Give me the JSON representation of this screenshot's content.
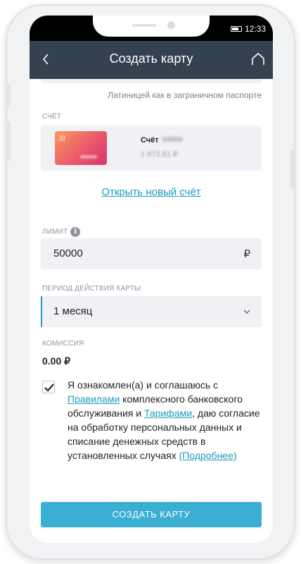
{
  "status_bar": {
    "time": "12:33"
  },
  "header": {
    "title": "Создать карту"
  },
  "name_field": {
    "hint": "Латиницей как в заграничном паспорте"
  },
  "account": {
    "label": "СЧЁТ",
    "title": "Счёт",
    "balance": "1 673.81 ₽",
    "open_new_link": "Открыть новый счёт"
  },
  "limit": {
    "label": "ЛИМИТ",
    "value": "50000",
    "currency": "₽"
  },
  "period": {
    "label": "ПЕРИОД ДЕЙСТВИЯ КАРТЫ",
    "selected": "1 месяц"
  },
  "commission": {
    "label": "КОМИССИЯ",
    "value": "0.00 ₽"
  },
  "agreement": {
    "checked": true,
    "text_1": "Я ознакомлен(а) и соглашаюсь с",
    "link_rules": "Правилами",
    "text_2": "комплексного банковского обслуживания и",
    "link_tariffs": "Тарифами",
    "text_3": ", даю согласие на обработку персональных данных и списание денежных средств в установленных случаях",
    "link_more": "(Подробнее)"
  },
  "create_button": {
    "label": "СОЗДАТЬ КАРТУ"
  },
  "colors": {
    "header_bg": "#344150",
    "accent": "#1b9bc0",
    "button_bg": "#3aaed3",
    "field_bg": "#f0f1f4"
  }
}
